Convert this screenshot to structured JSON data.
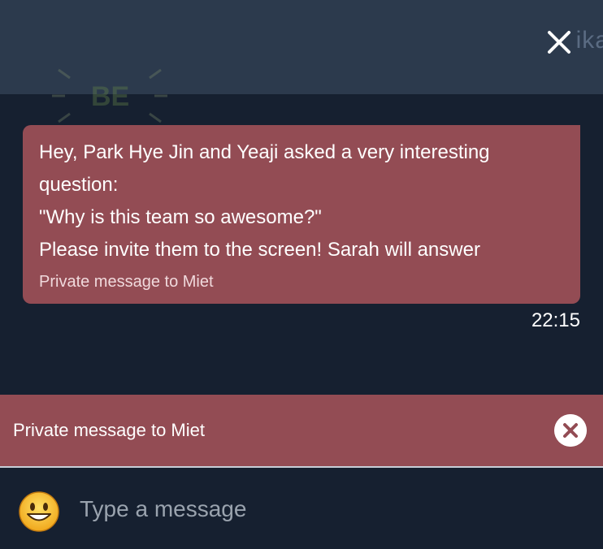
{
  "header": {
    "peek_text": "ika",
    "close_icon": "close-icon"
  },
  "message": {
    "lines": [
      "Hey, Park Hye Jin and Yeaji asked a very interesting",
      "question:",
      "\"Why is this team so awesome?\"",
      "Please invite them to the screen! Sarah will answer"
    ],
    "meta": "Private message to Miet",
    "time": "22:15"
  },
  "private_bar": {
    "label": "Private message to Miet",
    "close_icon": "close-circle-icon"
  },
  "composer": {
    "placeholder": "Type a message",
    "emoji_icon": "smiley-emoji-icon"
  },
  "colors": {
    "background": "#162030",
    "header": "#2c3a4d",
    "accent": "#934c54",
    "text": "#ffffff"
  }
}
